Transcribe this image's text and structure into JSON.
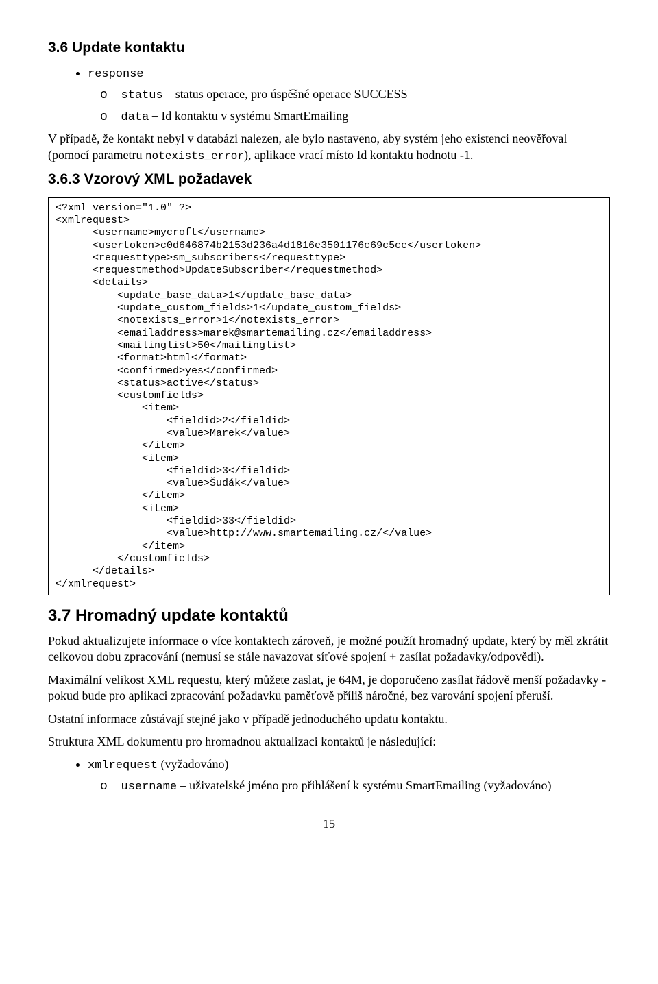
{
  "section36": {
    "title": "3.6 Update kontaktu",
    "bullet1": "response",
    "sub1_label": "status",
    "sub1_text": " – status operace, pro úspěšné operace SUCCESS",
    "sub2_label": "data",
    "sub2_text": " – Id kontaktu v systému SmartEmailing",
    "para_before": "V případě, že kontakt nebyl v databázi nalezen, ale bylo nastaveno, aby systém jeho existenci neověřoval (pomocí parametru ",
    "para_code": "notexists_error",
    "para_after": "), aplikace vrací místo Id kontaktu hodnotu -1."
  },
  "section363": {
    "title": "3.6.3 Vzorový XML požadavek",
    "code": "<?xml version=\"1.0\" ?>\n<xmlrequest>\n      <username>mycroft</username>\n      <usertoken>c0d646874b2153d236a4d1816e3501176c69c5ce</usertoken>\n      <requesttype>sm_subscribers</requesttype>\n      <requestmethod>UpdateSubscriber</requestmethod>\n      <details>\n          <update_base_data>1</update_base_data>\n          <update_custom_fields>1</update_custom_fields>\n          <notexists_error>1</notexists_error>\n          <emailaddress>marek@smartemailing.cz</emailaddress>\n          <mailinglist>50</mailinglist>\n          <format>html</format>\n          <confirmed>yes</confirmed>\n          <status>active</status>\n          <customfields>\n              <item>\n                  <fieldid>2</fieldid>\n                  <value>Marek</value>\n              </item>\n              <item>\n                  <fieldid>3</fieldid>\n                  <value>Šudák</value>\n              </item>\n              <item>\n                  <fieldid>33</fieldid>\n                  <value>http://www.smartemailing.cz/</value>\n              </item>\n          </customfields>\n      </details>\n</xmlrequest>"
  },
  "section37": {
    "title": "3.7 Hromadný update kontaktů",
    "p1": "Pokud aktualizujete informace o více kontaktech zároveň, je možné použít hromadný update, který by měl zkrátit celkovou dobu zpracování (nemusí se stále navazovat síťové spojení + zasílat požadavky/odpovědi).",
    "p2": "Maximální velikost XML requestu, který můžete zaslat, je 64M, je doporučeno zasílat řádově menší požadavky - pokud bude pro aplikaci zpracování požadavku paměťově příliš náročné, bez varování spojení přeruší.",
    "p3": "Ostatní informace zůstávají stejné jako v případě jednoduchého updatu kontaktu.",
    "p4": "Struktura XML dokumentu pro hromadnou aktualizaci kontaktů je následující:",
    "bullet1_code": "xmlrequest",
    "bullet1_text": " (vyžadováno)",
    "sub1_code": "username",
    "sub1_text": " – uživatelské jméno pro přihlášení k systému SmartEmailing (vyžadováno)"
  },
  "page_number": "15"
}
